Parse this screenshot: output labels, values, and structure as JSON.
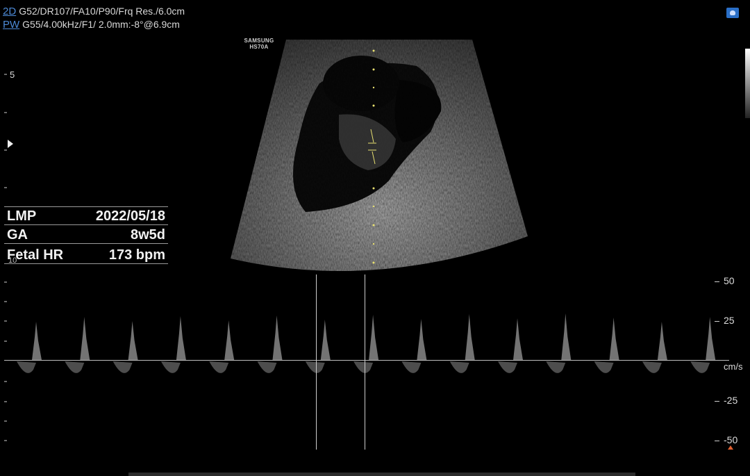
{
  "header": {
    "line1_mode": "2D",
    "line1_params": "G52/DR107/FA10/P90/Frq Res./6.0cm",
    "line2_mode": "PW",
    "line2_params": "G55/4.00kHz/F1/ 2.0mm:-8°@6.9cm"
  },
  "brand": {
    "line1": "SAMSUNG",
    "line2": "HS70A"
  },
  "depth_labels": {
    "upper": "5",
    "lower": "10"
  },
  "measurements": [
    {
      "label": "LMP",
      "value": "2022/05/18"
    },
    {
      "label": "GA",
      "value": "8w5d"
    },
    {
      "label": "Fetal HR",
      "value": "173  bpm"
    }
  ],
  "velocity_scale": {
    "unit": "cm/s",
    "labels": [
      "50",
      "25",
      "-25",
      "-50"
    ]
  },
  "doppler": {
    "heart_rate_bpm": 173
  },
  "colors": {
    "mode_label": "#4d8ad6",
    "sample_dots": "#e8e070",
    "probe_icon": "#2a6fc7"
  },
  "icons": {
    "probe": "probe-icon",
    "focus": "focus-marker-icon"
  }
}
